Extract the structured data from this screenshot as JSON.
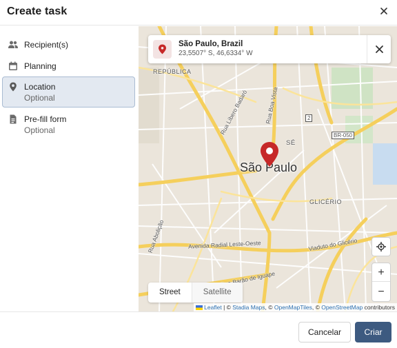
{
  "dialog": {
    "title": "Create task"
  },
  "sidebar": {
    "items": [
      {
        "label": "Recipient(s)",
        "icon": "people-icon"
      },
      {
        "label": "Planning",
        "icon": "calendar-icon"
      },
      {
        "label": "Location",
        "sublabel": "Optional",
        "icon": "location-pin-icon",
        "active": true
      },
      {
        "label": "Pre-fill form",
        "sublabel": "Optional",
        "icon": "document-icon"
      }
    ]
  },
  "map": {
    "location": {
      "name": "São Paulo, Brazil",
      "coords": "23,5507° S, 46,6334° W"
    },
    "city_label": "São Paulo",
    "labels": {
      "republica": "REPÚBLICA",
      "se": "SÉ",
      "glicerio": "GLICÉRIO",
      "br050": "BR-050",
      "shield2": "2",
      "street1": "Avenida Radial Leste-Oeste",
      "street2": "Viaduto do Glicério",
      "street3": "Rua Barão de Iguape",
      "street4": "Rua Líbero Badaró",
      "street5": "Rua Boa Vista",
      "street6": "Rua Abolição"
    },
    "layers": {
      "street": "Street",
      "satellite": "Satellite"
    },
    "zoom_in": "+",
    "zoom_out": "−",
    "attribution": {
      "leaflet": "Leaflet",
      "sep1": " | © ",
      "stadia": "Stadia Maps",
      "sep2": ", © ",
      "omt": "OpenMapTiles",
      "sep3": ", © ",
      "osm": "OpenStreetMap",
      "tail": " contributors"
    }
  },
  "footer": {
    "cancel": "Cancelar",
    "create": "Criar"
  },
  "colors": {
    "accent": "#3d5a80",
    "marker": "#c62828",
    "active_bg": "#e3e9f1",
    "road": "#f7d774"
  }
}
